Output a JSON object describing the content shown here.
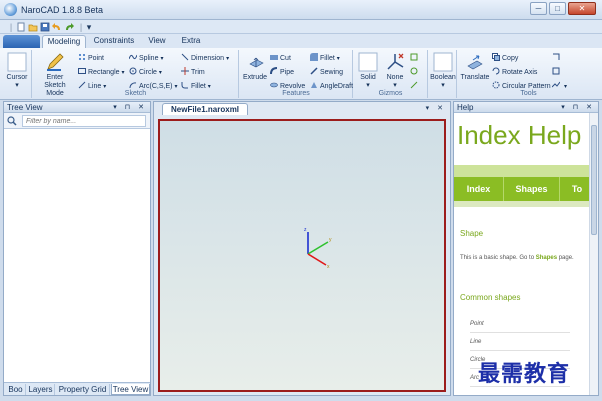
{
  "window": {
    "title": "NaroCAD 1.8.8 Beta",
    "minimize": "─",
    "maximize": "□",
    "close": "✕"
  },
  "qat": {
    "sep": "|",
    "items": [
      "new-icon",
      "open-icon",
      "save-icon",
      "undo-icon",
      "redo-icon"
    ],
    "dropdown": "▾"
  },
  "tabs": {
    "menu_label": "",
    "items": [
      "Modeling",
      "Constraints",
      "View",
      "Extra"
    ],
    "active": "Modeling"
  },
  "ribbon": {
    "cursor": "Cursor",
    "sketch": {
      "enter": "Enter Sketch Mode",
      "point": "Point",
      "rectangle": "Rectangle",
      "line": "Line",
      "spline": "Spline",
      "circle": "Circle",
      "arc": "Arc(C,S,E)",
      "dimension": "Dimension",
      "trim": "Trim",
      "fillet": "Fillet",
      "label": "Sketch"
    },
    "features": {
      "extrude": "Extrude",
      "cut": "Cut",
      "pipe": "Pipe",
      "revolve": "Revolve",
      "fillet": "Fillet",
      "sewing": "Sewing",
      "angledraft": "AngleDraft",
      "label": "Features"
    },
    "gizmos": {
      "solid": "Solid",
      "none": "None",
      "label": "Gizmos"
    },
    "boolean": "Boolean",
    "tools": {
      "translate": "Translate",
      "copy": "Copy",
      "rotate": "Rotate Axis",
      "pattern": "Circular Pattern",
      "label": "Tools"
    },
    "dropdown": "▾"
  },
  "tree_view": {
    "title": "Tree View",
    "controls": "▾ ⊓ ✕",
    "filter_placeholder": "Filter by name..."
  },
  "bottom_tabs": [
    "Boo",
    "Layers",
    "Property Grid",
    "Tree View"
  ],
  "document": {
    "tab": "NewFile1.naroxml",
    "controls": "▾ ✕"
  },
  "axes": {
    "x": "x",
    "y": "y",
    "z": "z"
  },
  "help": {
    "title": "Help",
    "controls": "▾ ⊓ ✕",
    "page_title": "Index Help",
    "nav": [
      "Index",
      "Shapes",
      "To"
    ],
    "section1": "Shape",
    "p1_prefix": "This is a basic shape. Go to ",
    "p1_link": "Shapes",
    "p1_suffix": " page.",
    "section2": "Common shapes",
    "list": [
      "Point",
      "Line",
      "Circle",
      "Arc"
    ]
  },
  "watermark": "最需教育"
}
